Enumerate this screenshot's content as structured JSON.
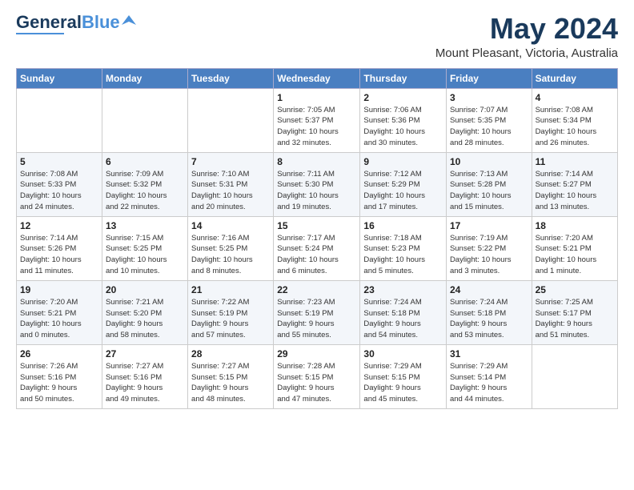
{
  "header": {
    "logo_general": "General",
    "logo_blue": "Blue",
    "month": "May 2024",
    "location": "Mount Pleasant, Victoria, Australia"
  },
  "weekdays": [
    "Sunday",
    "Monday",
    "Tuesday",
    "Wednesday",
    "Thursday",
    "Friday",
    "Saturday"
  ],
  "weeks": [
    [
      {
        "day": "",
        "info": ""
      },
      {
        "day": "",
        "info": ""
      },
      {
        "day": "",
        "info": ""
      },
      {
        "day": "1",
        "info": "Sunrise: 7:05 AM\nSunset: 5:37 PM\nDaylight: 10 hours\nand 32 minutes."
      },
      {
        "day": "2",
        "info": "Sunrise: 7:06 AM\nSunset: 5:36 PM\nDaylight: 10 hours\nand 30 minutes."
      },
      {
        "day": "3",
        "info": "Sunrise: 7:07 AM\nSunset: 5:35 PM\nDaylight: 10 hours\nand 28 minutes."
      },
      {
        "day": "4",
        "info": "Sunrise: 7:08 AM\nSunset: 5:34 PM\nDaylight: 10 hours\nand 26 minutes."
      }
    ],
    [
      {
        "day": "5",
        "info": "Sunrise: 7:08 AM\nSunset: 5:33 PM\nDaylight: 10 hours\nand 24 minutes."
      },
      {
        "day": "6",
        "info": "Sunrise: 7:09 AM\nSunset: 5:32 PM\nDaylight: 10 hours\nand 22 minutes."
      },
      {
        "day": "7",
        "info": "Sunrise: 7:10 AM\nSunset: 5:31 PM\nDaylight: 10 hours\nand 20 minutes."
      },
      {
        "day": "8",
        "info": "Sunrise: 7:11 AM\nSunset: 5:30 PM\nDaylight: 10 hours\nand 19 minutes."
      },
      {
        "day": "9",
        "info": "Sunrise: 7:12 AM\nSunset: 5:29 PM\nDaylight: 10 hours\nand 17 minutes."
      },
      {
        "day": "10",
        "info": "Sunrise: 7:13 AM\nSunset: 5:28 PM\nDaylight: 10 hours\nand 15 minutes."
      },
      {
        "day": "11",
        "info": "Sunrise: 7:14 AM\nSunset: 5:27 PM\nDaylight: 10 hours\nand 13 minutes."
      }
    ],
    [
      {
        "day": "12",
        "info": "Sunrise: 7:14 AM\nSunset: 5:26 PM\nDaylight: 10 hours\nand 11 minutes."
      },
      {
        "day": "13",
        "info": "Sunrise: 7:15 AM\nSunset: 5:25 PM\nDaylight: 10 hours\nand 10 minutes."
      },
      {
        "day": "14",
        "info": "Sunrise: 7:16 AM\nSunset: 5:25 PM\nDaylight: 10 hours\nand 8 minutes."
      },
      {
        "day": "15",
        "info": "Sunrise: 7:17 AM\nSunset: 5:24 PM\nDaylight: 10 hours\nand 6 minutes."
      },
      {
        "day": "16",
        "info": "Sunrise: 7:18 AM\nSunset: 5:23 PM\nDaylight: 10 hours\nand 5 minutes."
      },
      {
        "day": "17",
        "info": "Sunrise: 7:19 AM\nSunset: 5:22 PM\nDaylight: 10 hours\nand 3 minutes."
      },
      {
        "day": "18",
        "info": "Sunrise: 7:20 AM\nSunset: 5:21 PM\nDaylight: 10 hours\nand 1 minute."
      }
    ],
    [
      {
        "day": "19",
        "info": "Sunrise: 7:20 AM\nSunset: 5:21 PM\nDaylight: 10 hours\nand 0 minutes."
      },
      {
        "day": "20",
        "info": "Sunrise: 7:21 AM\nSunset: 5:20 PM\nDaylight: 9 hours\nand 58 minutes."
      },
      {
        "day": "21",
        "info": "Sunrise: 7:22 AM\nSunset: 5:19 PM\nDaylight: 9 hours\nand 57 minutes."
      },
      {
        "day": "22",
        "info": "Sunrise: 7:23 AM\nSunset: 5:19 PM\nDaylight: 9 hours\nand 55 minutes."
      },
      {
        "day": "23",
        "info": "Sunrise: 7:24 AM\nSunset: 5:18 PM\nDaylight: 9 hours\nand 54 minutes."
      },
      {
        "day": "24",
        "info": "Sunrise: 7:24 AM\nSunset: 5:18 PM\nDaylight: 9 hours\nand 53 minutes."
      },
      {
        "day": "25",
        "info": "Sunrise: 7:25 AM\nSunset: 5:17 PM\nDaylight: 9 hours\nand 51 minutes."
      }
    ],
    [
      {
        "day": "26",
        "info": "Sunrise: 7:26 AM\nSunset: 5:16 PM\nDaylight: 9 hours\nand 50 minutes."
      },
      {
        "day": "27",
        "info": "Sunrise: 7:27 AM\nSunset: 5:16 PM\nDaylight: 9 hours\nand 49 minutes."
      },
      {
        "day": "28",
        "info": "Sunrise: 7:27 AM\nSunset: 5:15 PM\nDaylight: 9 hours\nand 48 minutes."
      },
      {
        "day": "29",
        "info": "Sunrise: 7:28 AM\nSunset: 5:15 PM\nDaylight: 9 hours\nand 47 minutes."
      },
      {
        "day": "30",
        "info": "Sunrise: 7:29 AM\nSunset: 5:15 PM\nDaylight: 9 hours\nand 45 minutes."
      },
      {
        "day": "31",
        "info": "Sunrise: 7:29 AM\nSunset: 5:14 PM\nDaylight: 9 hours\nand 44 minutes."
      },
      {
        "day": "",
        "info": ""
      }
    ]
  ]
}
